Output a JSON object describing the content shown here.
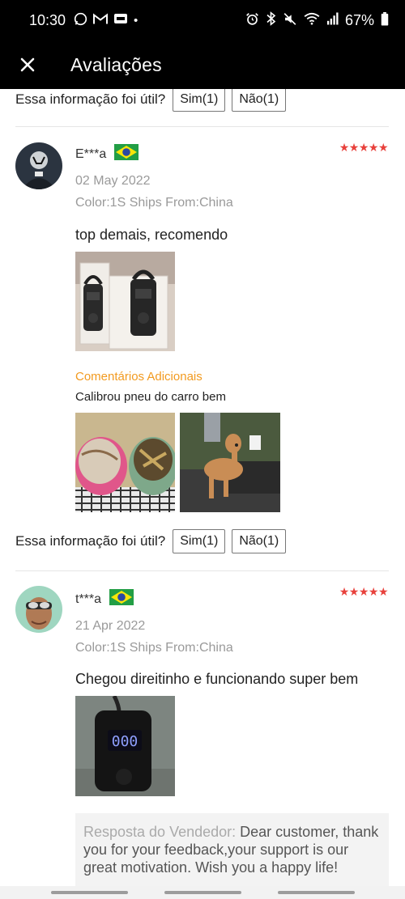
{
  "status_bar": {
    "time": "10:30",
    "battery": "67%"
  },
  "header": {
    "title": "Avaliações"
  },
  "helpful": {
    "question": "Essa informação foi útil?",
    "yes_label": "Sim(1)",
    "no_label": "Não(1)"
  },
  "reviews": [
    {
      "reviewer": "E***a",
      "date": "02 May 2022",
      "variant": "Color:1S Ships From:China",
      "text": "top demais, recomendo",
      "additional_label": "Comentários Adicionais",
      "additional_text": "Calibrou pneu do carro bem",
      "helpful_yes": "Sim(1)",
      "helpful_no": "Não(1)"
    },
    {
      "reviewer": "t***a",
      "date": "21 Apr 2022",
      "variant": "Color:1S Ships From:China",
      "text": "Chegou direitinho e funcionando super bem",
      "photo_display": "000",
      "seller_reply_label": "Resposta do Vendedor:",
      "seller_reply_text": "Dear customer, thank you for your feedback,your support is our great motivation. Wish you a happy life!"
    }
  ],
  "colors": {
    "star": "#e8413c",
    "additional_label": "#f29a1f",
    "header_bg": "#000000"
  },
  "icons": [
    "close-icon",
    "whatsapp-icon",
    "gmail-icon",
    "alarm-icon",
    "bluetooth-icon",
    "mute-icon",
    "wifi-icon",
    "signal-icon",
    "battery-icon",
    "star-icon",
    "brazil-flag-icon"
  ]
}
